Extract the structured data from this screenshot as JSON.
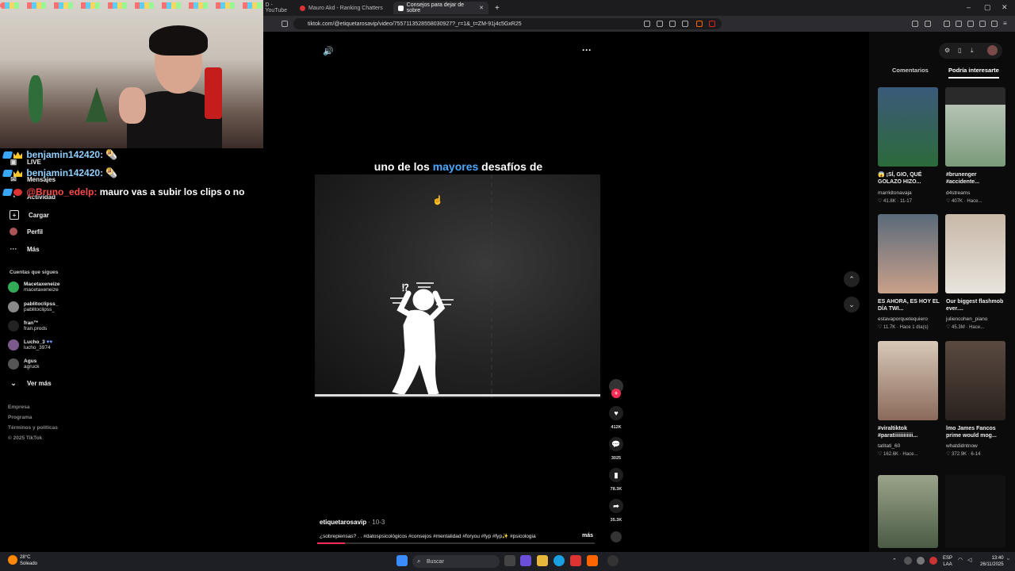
{
  "browser": {
    "tabs": [
      {
        "label": "D - YouTube"
      },
      {
        "label": "Mauro Akd - Ranking Chatters"
      },
      {
        "label": "Consejos para dejar de sobre"
      }
    ],
    "url": "tiktok.com/@etiquetarosavip/video/7557113528558030927?_r=1&_t=ZM-91j4c5GxR25"
  },
  "stream_chat": [
    {
      "user": "benjamin142420:",
      "message": "",
      "color": "#8fd0ff"
    },
    {
      "user": "benjamin142420:",
      "message": "",
      "color": "#8fd0ff"
    },
    {
      "user": "@Bruno_edelp:",
      "message": "mauro vas a subir los clips o no",
      "color": "#ff4b4b"
    }
  ],
  "tiktok_nav": {
    "items": [
      {
        "label": "LIVE",
        "icon": "live-icon"
      },
      {
        "label": "Mensajes",
        "icon": "message-icon"
      },
      {
        "label": "Actividad",
        "icon": "activity-icon"
      },
      {
        "label": "Cargar",
        "icon": "upload-icon"
      },
      {
        "label": "Perfil",
        "icon": "profile-icon"
      },
      {
        "label": "Más",
        "icon": "more-icon"
      }
    ],
    "following_title": "Cuentas que sigues",
    "following": [
      {
        "name": "Macetaxeneize",
        "handle": "macetaxeneize"
      },
      {
        "name": "pablitoclipss_",
        "handle": "pablitoclipss_"
      },
      {
        "name": "fran™",
        "handle": "fran.prods"
      },
      {
        "name": "Lucho_3",
        "handle": "lucho_3974"
      },
      {
        "name": "Agus",
        "handle": "agruck"
      }
    ],
    "see_more": "Ver más",
    "footer": [
      "Empresa",
      "Programa",
      "Términos y políticas",
      "© 2025 TikTok"
    ]
  },
  "video": {
    "caption_before": "uno de los ",
    "caption_highlight": "mayores",
    "caption_after": " desafíos de",
    "author": "etiquetarosavip",
    "date": "· 10-3",
    "description": "¿sobrepiensas? . . #datospsicológicos #consejos #mentalidad #foryou #fyp #fyp✨ #psicologia",
    "more": "más",
    "likes": "412K",
    "comments": "3025",
    "saves": "78.3K",
    "shares": "35.3K"
  },
  "right_panel": {
    "tabs": [
      "Comentarios",
      "Podría interesarte"
    ],
    "videos": [
      {
        "title": "😱 ¡SÍ, GIO, QUÉ GOLAZO HIZO...",
        "user": "marrkitonavaja",
        "likes": "♡ 41.8K",
        "age": "11-17",
        "color": "#3b5a7a"
      },
      {
        "title": "#brunenger #accidente...",
        "user": "d4streams",
        "likes": "♡ 407K",
        "age": "Hace...",
        "color": "#9cb0a4"
      },
      {
        "title": "ES AHORA, ES HOY EL DÍA TWI...",
        "user": "estavaporquetequiero",
        "likes": "♡ 11.7K",
        "age": "Hace 1 día(s)",
        "color": "#6a7a8c"
      },
      {
        "title": "Our biggest flashmob ever....",
        "user": "juliencohen_piano",
        "likes": "♡ 45.3M",
        "age": "Hace...",
        "color": "#b8a99a"
      },
      {
        "title": "#viraltiktok #paratiiiiiiiiiiii...",
        "user": "tatitati_60",
        "likes": "♡ 162.6K",
        "age": "Hace...",
        "color": "#a9877a"
      },
      {
        "title": "lmo James Fancos prime would mog...",
        "user": "whatdidntnow",
        "likes": "♡ 372.9K",
        "age": "6-14",
        "color": "#4a3a32"
      },
      {
        "title": "",
        "user": "",
        "likes": "",
        "age": "",
        "color": "#6f7f6a"
      },
      {
        "title": "",
        "user": "",
        "likes": "",
        "age": "",
        "color": "#111111"
      }
    ]
  },
  "taskbar": {
    "weather_temp": "28°C",
    "weather_desc": "Soleado",
    "search_placeholder": "Buscar",
    "lang_top": "ESP",
    "lang_bottom": "LAA",
    "time": "13:40",
    "date": "26/11/2025"
  }
}
